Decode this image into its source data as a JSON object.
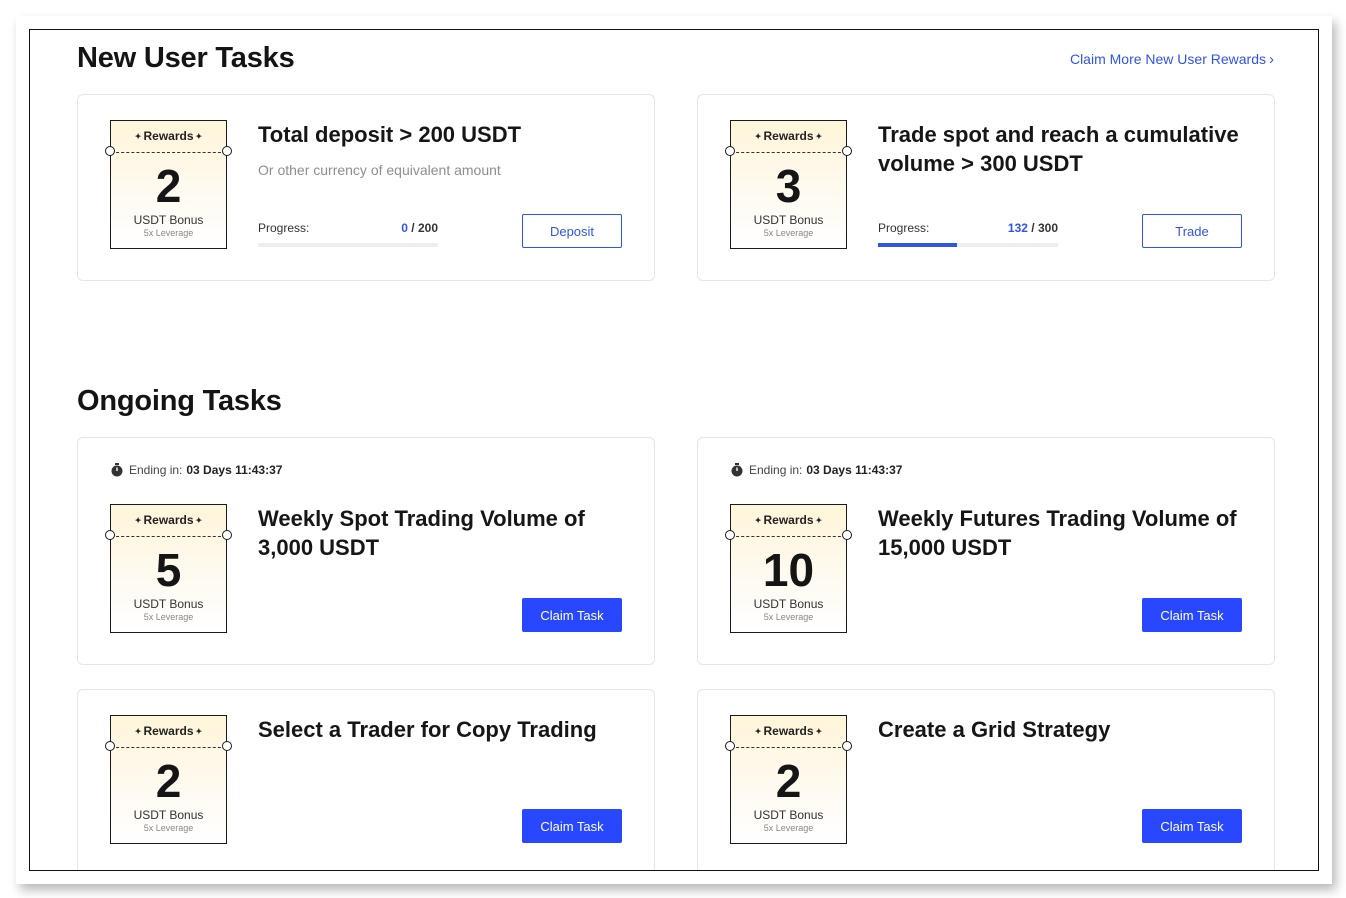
{
  "new_user": {
    "title": "New User Tasks",
    "claim_link": "Claim More New User Rewards",
    "tasks": [
      {
        "reward_label": "Rewards",
        "amount": "2",
        "unit": "USDT Bonus",
        "leverage": "5x Leverage",
        "title": "Total deposit > 200 USDT",
        "subtitle": "Or other currency of equivalent amount",
        "progress_label": "Progress:",
        "progress_current": "0",
        "progress_sep": " / ",
        "progress_total": "200",
        "progress_fraction": 0,
        "button": "Deposit"
      },
      {
        "reward_label": "Rewards",
        "amount": "3",
        "unit": "USDT Bonus",
        "leverage": "5x Leverage",
        "title": "Trade spot and reach a cumulative volume > 300 USDT",
        "progress_label": "Progress:",
        "progress_current": "132",
        "progress_sep": " / ",
        "progress_total": "300",
        "progress_fraction": 0.44,
        "button": "Trade"
      }
    ]
  },
  "ongoing": {
    "title": "Ongoing Tasks",
    "tasks": [
      {
        "ending_label": "Ending in:",
        "ending_value": "03 Days 11:43:37",
        "reward_label": "Rewards",
        "amount": "5",
        "unit": "USDT Bonus",
        "leverage": "5x Leverage",
        "title": "Weekly Spot Trading Volume of 3,000 USDT",
        "button": "Claim Task"
      },
      {
        "ending_label": "Ending in:",
        "ending_value": "03 Days 11:43:37",
        "reward_label": "Rewards",
        "amount": "10",
        "unit": "USDT Bonus",
        "leverage": "5x Leverage",
        "title": "Weekly Futures Trading Volume of 15,000 USDT",
        "button": "Claim Task"
      },
      {
        "reward_label": "Rewards",
        "amount": "2",
        "unit": "USDT Bonus",
        "leverage": "5x Leverage",
        "title": "Select a Trader for Copy Trading",
        "button": "Claim Task"
      },
      {
        "reward_label": "Rewards",
        "amount": "2",
        "unit": "USDT Bonus",
        "leverage": "5x Leverage",
        "title": "Create a Grid Strategy",
        "button": "Claim Task"
      }
    ]
  },
  "colors": {
    "accent": "#2f54eb",
    "button_fill": "#2748ff",
    "ticket_gradient_top": "#fff5d9"
  }
}
